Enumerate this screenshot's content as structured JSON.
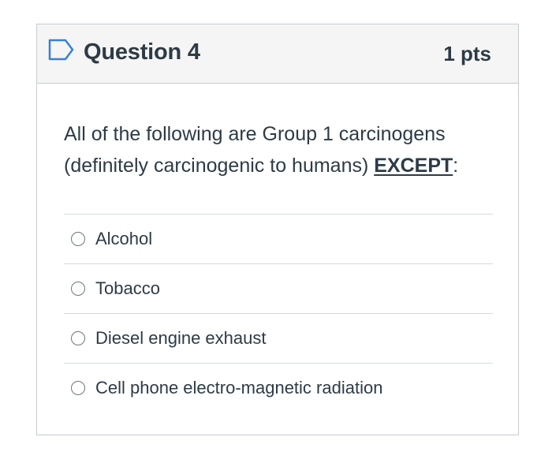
{
  "question": {
    "title": "Question 4",
    "points": "1 pts",
    "text_main": "All of the following are Group 1 carcinogens (definitely carcinogenic to humans) ",
    "text_emphasis": "EXCEPT",
    "text_suffix": ":",
    "icon": "flag-outline-icon"
  },
  "answers": [
    {
      "label": "Alcohol"
    },
    {
      "label": "Tobacco"
    },
    {
      "label": "Diesel engine exhaust"
    },
    {
      "label": "Cell phone electro-magnetic radiation"
    }
  ],
  "colors": {
    "text": "#2d3b45",
    "header_bg": "#f5f5f5",
    "border": "#c7cdd1",
    "flag": "#3b7fd1"
  }
}
